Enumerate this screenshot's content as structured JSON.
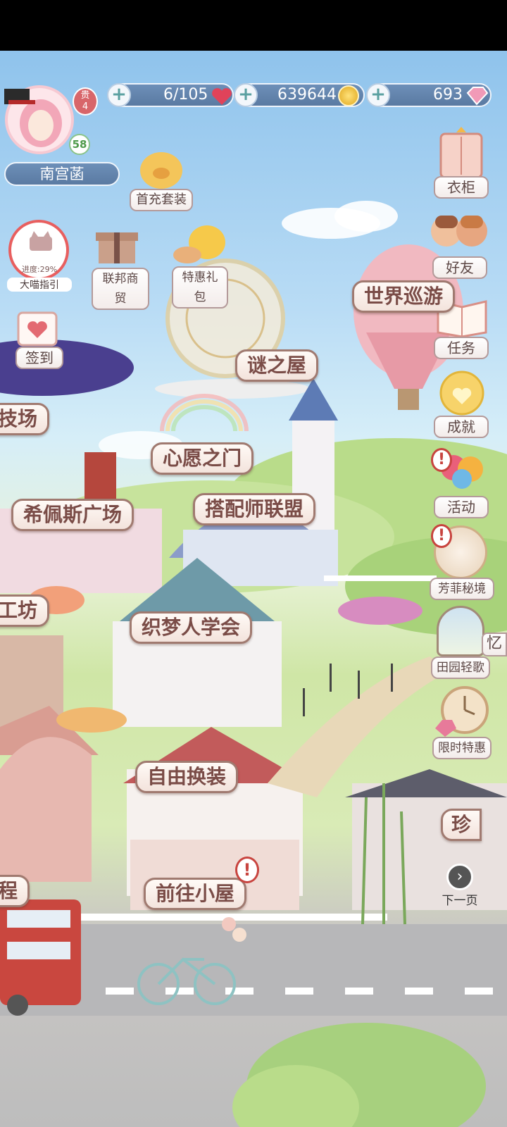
{
  "player": {
    "name": "南宫菡",
    "level": "58",
    "vip_label": "贵",
    "vip_level": "4"
  },
  "resources": {
    "hearts": "6/105",
    "coins": "639644",
    "diamonds": "693"
  },
  "left_menu": {
    "first_recharge": "首充套装",
    "federation_trade": "联邦商贸",
    "special_pack": "特惠礼包",
    "guide_progress": "进度:29%",
    "guide_label": "大喵指引",
    "sign_in": "签到"
  },
  "right_menu": {
    "wardrobe": "衣柜",
    "friends": "好友",
    "tasks": "任务",
    "achievements": "成就",
    "activities": "活动",
    "fangfei": "芳菲秘境",
    "pastoral": "田园轻歌",
    "limited_sale": "限时特惠",
    "next_page": "下一页",
    "partial_label": "忆"
  },
  "locations": {
    "mystery_house": "谜之屋",
    "world_tour": "世界巡游",
    "arena_partial": "技场",
    "wish_gate": "心愿之门",
    "hesperus_square": "希佩斯广场",
    "stylist_alliance": "搭配师联盟",
    "workshop_partial": "工坊",
    "dream_weaver": "织梦人学会",
    "free_dress": "自由换装",
    "go_home": "前往小屋",
    "cheng_partial": "程",
    "treasure_partial": "珍"
  },
  "colors": {
    "sky": "#8fc3ec",
    "grass": "#cfe6a6",
    "road": "#bdbdbd",
    "sign_text": "#7a4c47",
    "alert": "#c8443f"
  }
}
